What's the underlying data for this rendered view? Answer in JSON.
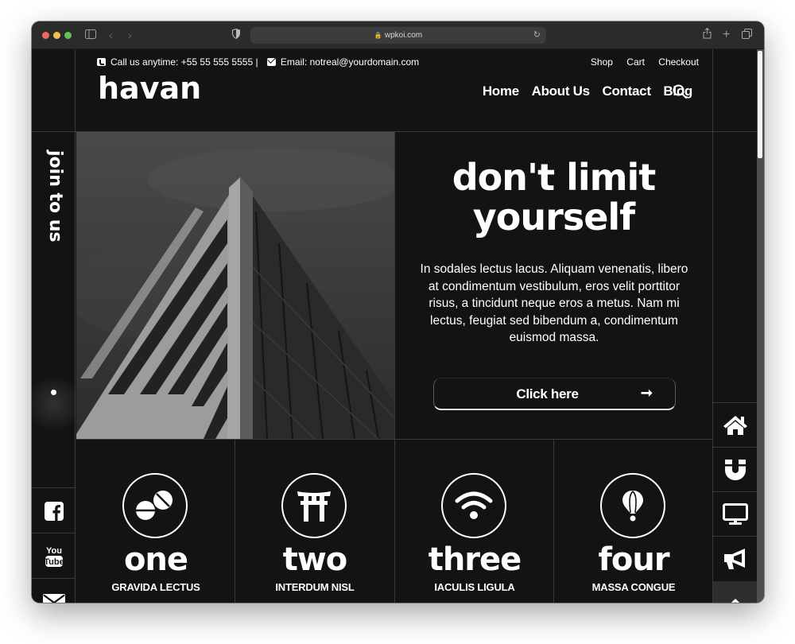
{
  "browser": {
    "url": "wpkoi.com"
  },
  "topbar": {
    "phone_text": "Call us anytime: +55 55 555 5555 |",
    "email_text": "Email: notreal@yourdomain.com",
    "links": [
      "Shop",
      "Cart",
      "Checkout"
    ]
  },
  "header": {
    "logo": "havan",
    "nav": [
      "Home",
      "About Us",
      "Contact",
      "Blog"
    ],
    "search_icon": "search-icon"
  },
  "left_sidebar": {
    "vertical_text": "join to us",
    "social": [
      "facebook-icon",
      "youtube-icon",
      "envelope-icon"
    ]
  },
  "hero": {
    "image_alt": "black and white skyscraper corner against cloudy sky",
    "title_line1": "don't limit",
    "title_line2": "yourself",
    "paragraph": "In sodales lectus lacus. Aliquam venenatis, libero at condimentum vestibulum, eros velit porttitor risus, a tincidunt neque eros a metus. Nam mi lectus, feugiat sed bibendum a, condimentum euismod massa.",
    "cta_label": "Click here",
    "cta_arrow": "➞"
  },
  "features": [
    {
      "icon": "pills-icon",
      "number": "one",
      "subtitle": "GRAVIDA LECTUS"
    },
    {
      "icon": "torii-gate-icon",
      "number": "two",
      "subtitle": "INTERDUM NISL"
    },
    {
      "icon": "wifi-icon",
      "number": "three",
      "subtitle": "IACULIS LIGULA"
    },
    {
      "icon": "hot-air-balloon-icon",
      "number": "four",
      "subtitle": "MASSA CONGUE"
    }
  ],
  "right_sidebar": {
    "buttons": [
      "home-icon",
      "magnet-icon",
      "monitor-icon",
      "megaphone-icon",
      "chevron-up-icon"
    ]
  },
  "colors": {
    "background": "#131313",
    "text": "#ffffff",
    "divider": "#3a3a3a",
    "scroll_top_bg": "#2e2e2e"
  }
}
